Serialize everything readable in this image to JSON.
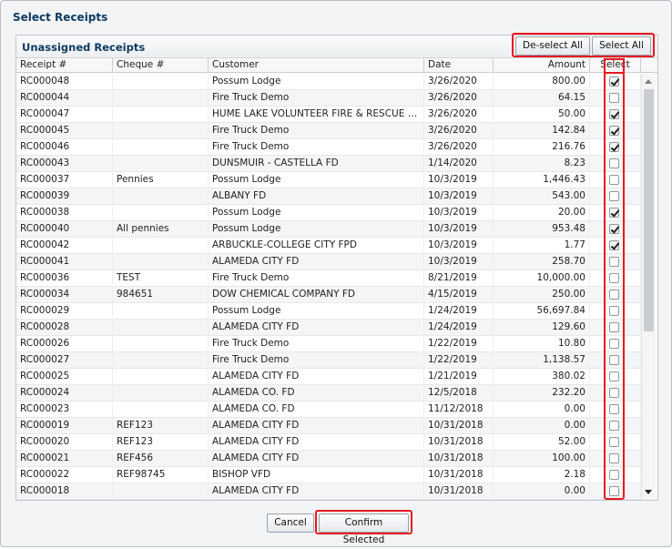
{
  "dialog": {
    "title": "Select Receipts"
  },
  "panel": {
    "title": "Unassigned Receipts",
    "deselect_all_label": "De-select All",
    "select_all_label": "Select All"
  },
  "columns": {
    "receipt": "Receipt #",
    "cheque": "Cheque #",
    "customer": "Customer",
    "date": "Date",
    "amount": "Amount",
    "select": "Select"
  },
  "rows": [
    {
      "receipt": "RC000048",
      "cheque": "",
      "customer": "Possum Lodge",
      "date": "3/26/2020",
      "amount": "800.00",
      "selected": true
    },
    {
      "receipt": "RC000044",
      "cheque": "",
      "customer": "Fire Truck Demo",
      "date": "3/26/2020",
      "amount": "64.15",
      "selected": false
    },
    {
      "receipt": "RC000047",
      "cheque": "",
      "customer": "HUME LAKE VOLUNTEER FIRE & RESCUE CO...",
      "date": "3/26/2020",
      "amount": "50.00",
      "selected": true
    },
    {
      "receipt": "RC000045",
      "cheque": "",
      "customer": "Fire Truck Demo",
      "date": "3/26/2020",
      "amount": "142.84",
      "selected": true
    },
    {
      "receipt": "RC000046",
      "cheque": "",
      "customer": "Fire Truck Demo",
      "date": "3/26/2020",
      "amount": "216.76",
      "selected": true
    },
    {
      "receipt": "RC000043",
      "cheque": "",
      "customer": "DUNSMUIR - CASTELLA FD",
      "date": "1/14/2020",
      "amount": "8.23",
      "selected": false
    },
    {
      "receipt": "RC000037",
      "cheque": "Pennies",
      "customer": "Possum Lodge",
      "date": "10/3/2019",
      "amount": "1,446.43",
      "selected": false
    },
    {
      "receipt": "RC000039",
      "cheque": "",
      "customer": "ALBANY FD",
      "date": "10/3/2019",
      "amount": "543.00",
      "selected": false
    },
    {
      "receipt": "RC000038",
      "cheque": "",
      "customer": "Possum Lodge",
      "date": "10/3/2019",
      "amount": "20.00",
      "selected": true
    },
    {
      "receipt": "RC000040",
      "cheque": "All pennies",
      "customer": "Possum Lodge",
      "date": "10/3/2019",
      "amount": "953.48",
      "selected": true
    },
    {
      "receipt": "RC000042",
      "cheque": "",
      "customer": "ARBUCKLE-COLLEGE CITY FPD",
      "date": "10/3/2019",
      "amount": "1.77",
      "selected": true
    },
    {
      "receipt": "RC000041",
      "cheque": "",
      "customer": "ALAMEDA CITY FD",
      "date": "10/3/2019",
      "amount": "258.70",
      "selected": false
    },
    {
      "receipt": "RC000036",
      "cheque": "TEST",
      "customer": "Fire Truck Demo",
      "date": "8/21/2019",
      "amount": "10,000.00",
      "selected": false
    },
    {
      "receipt": "RC000034",
      "cheque": "984651",
      "customer": "DOW CHEMICAL COMPANY FD",
      "date": "4/15/2019",
      "amount": "250.00",
      "selected": false
    },
    {
      "receipt": "RC000029",
      "cheque": "",
      "customer": "Possum Lodge",
      "date": "1/24/2019",
      "amount": "56,697.84",
      "selected": false
    },
    {
      "receipt": "RC000028",
      "cheque": "",
      "customer": "ALAMEDA CITY FD",
      "date": "1/24/2019",
      "amount": "129.60",
      "selected": false
    },
    {
      "receipt": "RC000026",
      "cheque": "",
      "customer": "Fire Truck Demo",
      "date": "1/22/2019",
      "amount": "10.80",
      "selected": false
    },
    {
      "receipt": "RC000027",
      "cheque": "",
      "customer": "Fire Truck Demo",
      "date": "1/22/2019",
      "amount": "1,138.57",
      "selected": false
    },
    {
      "receipt": "RC000025",
      "cheque": "",
      "customer": "ALAMEDA CITY FD",
      "date": "1/21/2019",
      "amount": "380.02",
      "selected": false
    },
    {
      "receipt": "RC000024",
      "cheque": "",
      "customer": "ALAMEDA CO. FD",
      "date": "12/5/2018",
      "amount": "232.20",
      "selected": false
    },
    {
      "receipt": "RC000023",
      "cheque": "",
      "customer": "ALAMEDA CO. FD",
      "date": "11/12/2018",
      "amount": "0.00",
      "selected": false
    },
    {
      "receipt": "RC000019",
      "cheque": "REF123",
      "customer": "ALAMEDA CITY FD",
      "date": "10/31/2018",
      "amount": "0.00",
      "selected": false
    },
    {
      "receipt": "RC000020",
      "cheque": "REF123",
      "customer": "ALAMEDA CITY FD",
      "date": "10/31/2018",
      "amount": "52.00",
      "selected": false
    },
    {
      "receipt": "RC000021",
      "cheque": "REF456",
      "customer": "ALAMEDA CITY FD",
      "date": "10/31/2018",
      "amount": "100.00",
      "selected": false
    },
    {
      "receipt": "RC000022",
      "cheque": "REF98745",
      "customer": "BISHOP VFD",
      "date": "10/31/2018",
      "amount": "2.18",
      "selected": false
    },
    {
      "receipt": "RC000018",
      "cheque": "",
      "customer": "ALAMEDA CITY FD",
      "date": "10/31/2018",
      "amount": "0.00",
      "selected": false
    }
  ],
  "footer": {
    "cancel_label": "Cancel",
    "confirm_label": "Confirm Selected"
  },
  "colors": {
    "title_text": "#0d3a5e",
    "highlight": "#e8191f"
  }
}
